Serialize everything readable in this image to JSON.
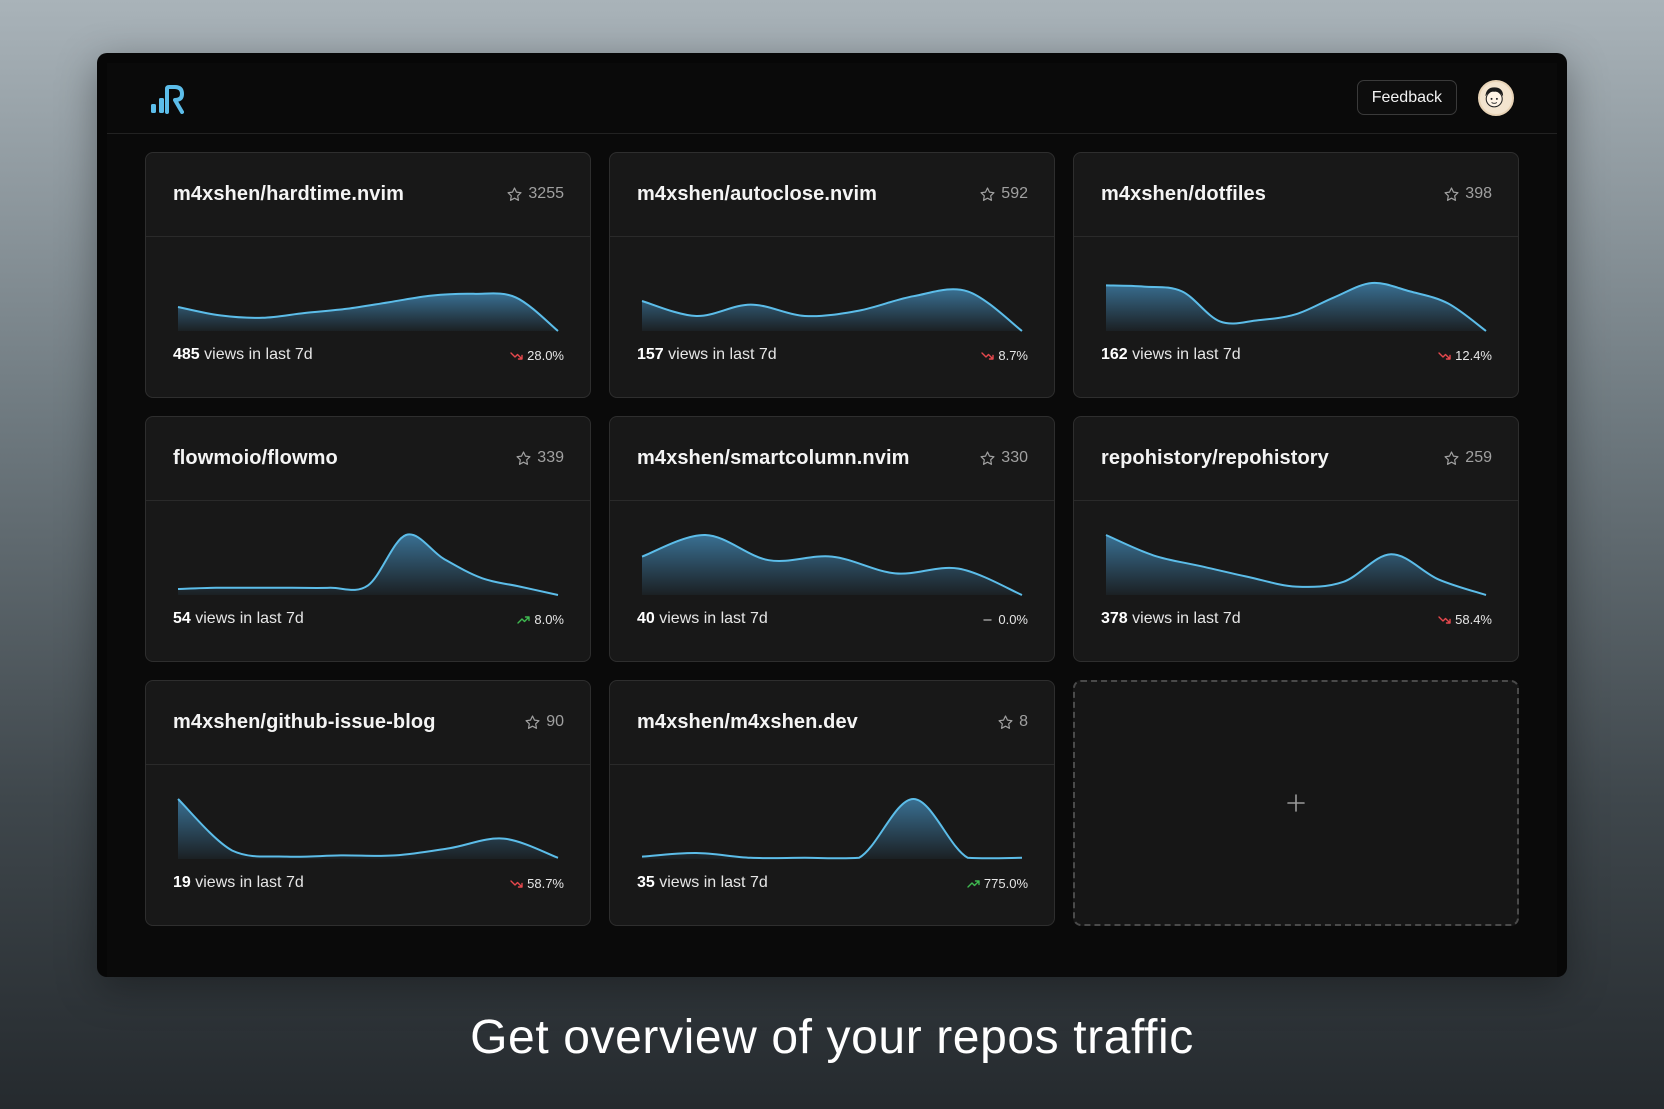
{
  "header": {
    "logo_icon": "repohistory-logo-icon",
    "feedback_label": "Feedback",
    "avatar_icon": "user-avatar-icon"
  },
  "colors": {
    "line": "#5cbde9",
    "fill_top": "#3f7fa8",
    "down": "#e5484d",
    "up": "#3fb950",
    "flat": "#9a9a9a"
  },
  "repos": [
    {
      "name": "m4xshen/hardtime.nvim",
      "stars": "3255",
      "views": "485",
      "views_suffix": "views in last 7d",
      "change": "28.0%",
      "trend": "down",
      "series": [
        40,
        26,
        22,
        30,
        37,
        48,
        59,
        62,
        56,
        0
      ]
    },
    {
      "name": "m4xshen/autoclose.nvim",
      "stars": "592",
      "views": "157",
      "views_suffix": "views in last 7d",
      "change": "8.7%",
      "trend": "down",
      "series": [
        50,
        25,
        44,
        25,
        34,
        58,
        66,
        0
      ]
    },
    {
      "name": "m4xshen/dotfiles",
      "stars": "398",
      "views": "162",
      "views_suffix": "views in last 7d",
      "change": "12.4%",
      "trend": "down",
      "series": [
        76,
        74,
        66,
        16,
        18,
        28,
        56,
        80,
        66,
        46,
        0
      ]
    },
    {
      "name": "flowmoio/flowmo",
      "stars": "339",
      "views": "54",
      "views_suffix": "views in last 7d",
      "change": "8.0%",
      "trend": "up",
      "series": [
        10,
        12,
        12,
        12,
        12,
        16,
        100,
        60,
        28,
        14,
        0
      ]
    },
    {
      "name": "m4xshen/smartcolumn.nvim",
      "stars": "330",
      "views": "40",
      "views_suffix": "views in last 7d",
      "change": "0.0%",
      "trend": "flat",
      "series": [
        64,
        100,
        58,
        64,
        36,
        44,
        0
      ]
    },
    {
      "name": "repohistory/repohistory",
      "stars": "259",
      "views": "378",
      "views_suffix": "views in last 7d",
      "change": "58.4%",
      "trend": "down",
      "series": [
        100,
        66,
        48,
        30,
        14,
        22,
        68,
        26,
        0
      ]
    },
    {
      "name": "m4xshen/github-issue-blog",
      "stars": "90",
      "views": "19",
      "views_suffix": "views in last 7d",
      "change": "58.7%",
      "trend": "down",
      "series": [
        100,
        14,
        4,
        6,
        6,
        18,
        34,
        2
      ]
    },
    {
      "name": "m4xshen/m4xshen.dev",
      "stars": "8",
      "views": "35",
      "views_suffix": "views in last 7d",
      "change": "775.0%",
      "trend": "up",
      "series": [
        4,
        10,
        2,
        2,
        2,
        100,
        2,
        2
      ]
    }
  ],
  "add_card": {
    "icon": "plus-icon"
  },
  "caption": "Get overview of your repos traffic"
}
